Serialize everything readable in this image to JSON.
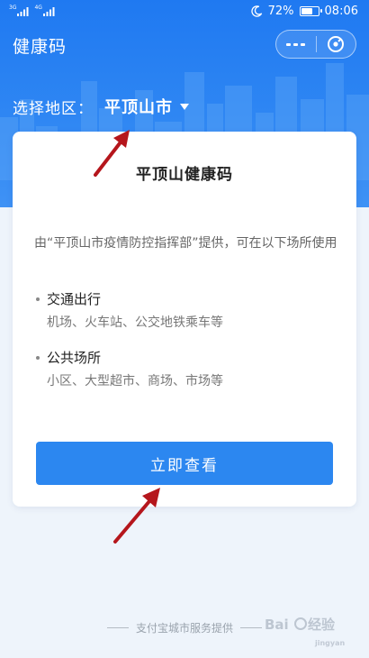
{
  "status_bar": {
    "sim1_label": "3G",
    "sim2_label": "4G",
    "battery_percent": "72%",
    "battery_level": 0.72,
    "time": "08:06"
  },
  "header": {
    "title": "健康码"
  },
  "region": {
    "label": "选择地区：",
    "value": "平顶山市"
  },
  "card": {
    "title": "平顶山健康码",
    "description": "由“平顶山市疫情防控指挥部”提供，可在以下场所使用",
    "usages": [
      {
        "title": "交通出行",
        "places": "机场、火车站、公交地铁乘车等"
      },
      {
        "title": "公共场所",
        "places": "小区、大型超市、商场、市场等"
      }
    ],
    "button_label": "立即查看"
  },
  "footer": {
    "text": "支付宝城市服务提供"
  },
  "watermark": {
    "text": "Baidu 经验"
  },
  "colors": {
    "primary": "#2c87f0",
    "annotation_arrow": "#b5161c"
  }
}
